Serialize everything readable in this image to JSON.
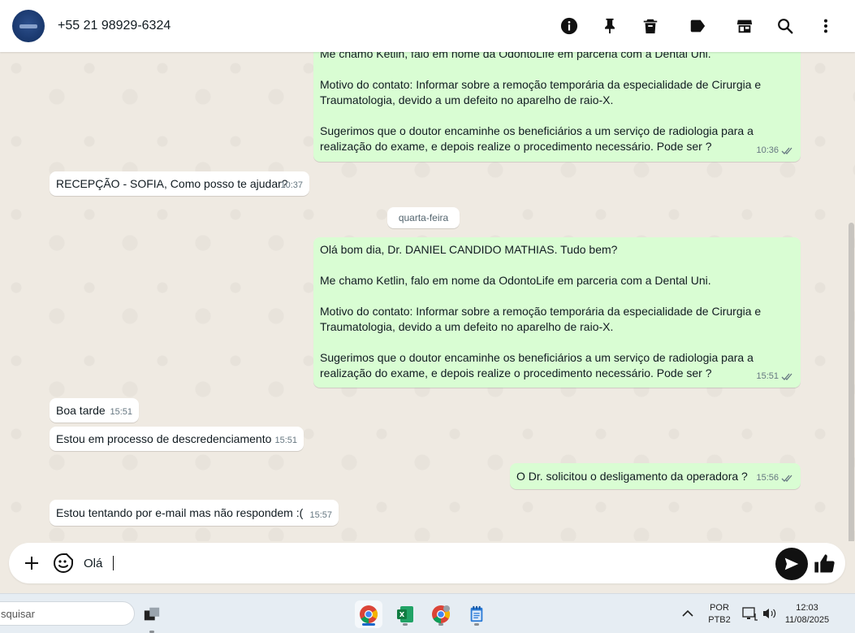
{
  "header": {
    "contact": "+55 21 98929-6324",
    "icons": [
      "info-icon",
      "pin-icon",
      "delete-icon",
      "label-icon",
      "shop-icon",
      "search-icon",
      "more-icon"
    ]
  },
  "messages": [
    {
      "dir": "out",
      "text": "Me chamo Ketlin, falo em nome da OdontoLife em parceria com a Dental Uni.\n\nMotivo do contato: Informar sobre a remoção temporária da especialidade de Cirurgia e Traumatologia, devido a um defeito no aparelho de raio-X.\n\nSugerimos que o doutor encaminhe os beneficiários a um serviço de radiologia para a realização do exame, e depois realize o procedimento necessário. Pode ser ?",
      "time": "10:36"
    },
    {
      "dir": "in",
      "text": "RECEPÇÃO - SOFIA, Como posso te ajudar?",
      "time": "10:37"
    },
    {
      "dir": "out",
      "text": "Olá bom dia, Dr. DANIEL CANDIDO MATHIAS. Tudo bem?\n\nMe chamo Ketlin, falo em nome da OdontoLife em parceria com a Dental Uni.\n\nMotivo do contato: Informar sobre a remoção temporária da especialidade de Cirurgia e Traumatologia, devido a um defeito no aparelho de raio-X.\n\nSugerimos que o doutor encaminhe os beneficiários a um serviço de radiologia para a realização do exame, e depois realize o procedimento necessário. Pode ser ?",
      "time": "15:51"
    },
    {
      "dir": "in",
      "text": "Boa tarde",
      "time": "15:51"
    },
    {
      "dir": "in",
      "text": "Estou em processo de descredenciamento",
      "time": "15:51"
    },
    {
      "dir": "out",
      "text": "O Dr. solicitou o desligamento da operadora ?",
      "time": "15:56"
    },
    {
      "dir": "in",
      "text": "Estou tentando por e-mail mas não respondem :(",
      "time": "15:57"
    }
  ],
  "day_separator": "quarta-feira",
  "composer": {
    "value": "Olá"
  },
  "taskbar": {
    "search_text": "squisar",
    "lang_top": "POR",
    "lang_bottom": "PTB2",
    "time": "12:03",
    "date": "11/08/2025"
  },
  "colors": {
    "outgoing_bubble": "#d9fdd3",
    "incoming_bubble": "#ffffff",
    "chat_background": "#efeae2"
  }
}
